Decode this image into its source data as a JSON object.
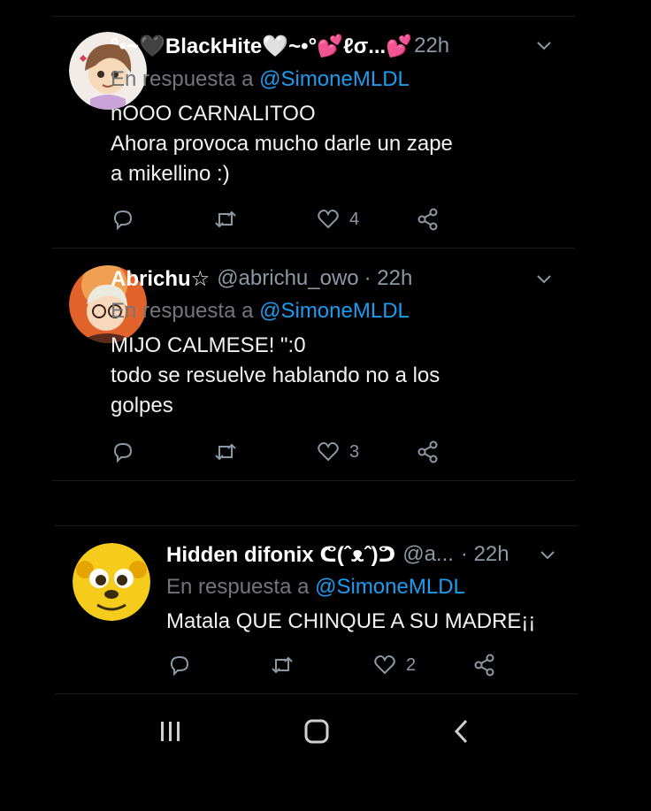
{
  "reply_prefix": "En respuesta a",
  "tweets": [
    {
      "name": "°•~🖤BlackHite🤍~•°💕ℓσ...💕",
      "handle": "",
      "time": "22h",
      "reply_to": "@SimoneMLDL",
      "lines": [
        "nOOO CARNALITOO",
        "Ahora provoca mucho darle un zape",
        "a mikellino :)"
      ],
      "likes": "4",
      "avatar_colors": [
        "#f1ece8",
        "#8a5a3c",
        "#c9a2d8"
      ]
    },
    {
      "name": "Abrichu☆",
      "handle": "@abrichu_owo",
      "time": "· 22h",
      "reply_to": "@SimoneMLDL",
      "lines": [
        "MIJO CALMESE! \":0",
        "todo se resuelve hablando no a los",
        "golpes"
      ],
      "likes": "3",
      "avatar_colors": [
        "#e1622a",
        "#f2b05a",
        "#5b2c1c"
      ]
    },
    {
      "name": "Hidden difonix ᕦ(ˆᴥˆ)ᕤ",
      "handle": "@a...",
      "time": "· 22h",
      "reply_to": "@SimoneMLDL",
      "lines": [
        "Matala QUE CHINQUE A SU MADRE¡¡"
      ],
      "likes": "2",
      "avatar_colors": [
        "#f6cc1c",
        "#3a2a10",
        "#e6a400"
      ]
    }
  ],
  "navbar": {
    "icons": [
      "recent-apps-icon",
      "home-icon",
      "back-icon"
    ]
  },
  "colors": {
    "background": "#000000",
    "mention": "#1d9bf0",
    "muted": "#8b98a5"
  }
}
